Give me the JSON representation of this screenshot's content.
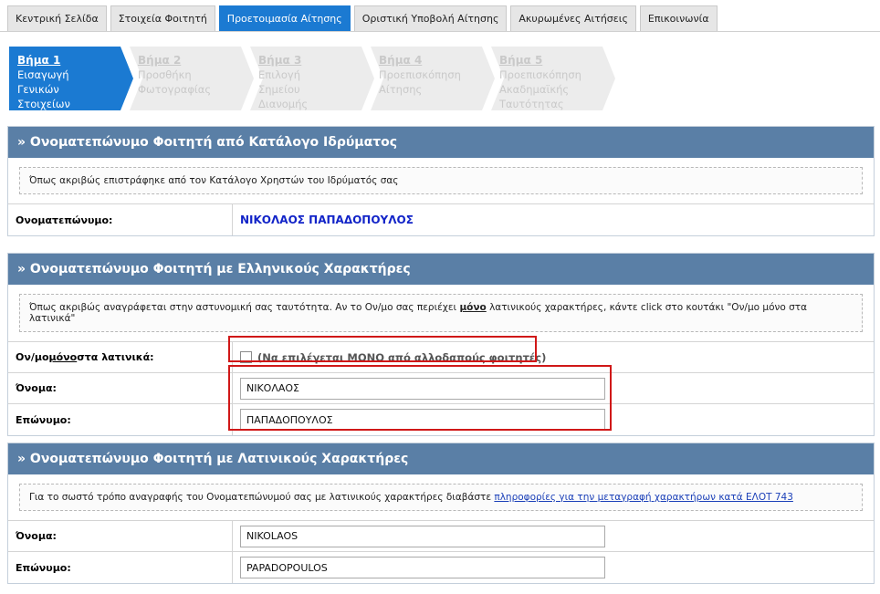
{
  "tabs": [
    {
      "label": "Κεντρική Σελίδα",
      "active": false
    },
    {
      "label": "Στοιχεία Φοιτητή",
      "active": false
    },
    {
      "label": "Προετοιμασία Αίτησης",
      "active": true
    },
    {
      "label": "Οριστική Υποβολή Αίτησης",
      "active": false
    },
    {
      "label": "Ακυρωμένες Αιτήσεις",
      "active": false
    },
    {
      "label": "Επικοινωνία",
      "active": false
    }
  ],
  "steps": [
    {
      "num": "Βήμα 1",
      "line1": "Εισαγωγή Γενικών",
      "line2": "Στοιχείων",
      "line3": "",
      "active": true
    },
    {
      "num": "Βήμα 2",
      "line1": "Προσθήκη",
      "line2": "Φωτογραφίας",
      "line3": "",
      "active": false
    },
    {
      "num": "Βήμα 3",
      "line1": "Επιλογή Σημείου",
      "line2": "Διανομής",
      "line3": "",
      "active": false
    },
    {
      "num": "Βήμα 4",
      "line1": "Προεπισκόπηση",
      "line2": "Αίτησης",
      "line3": "",
      "active": false
    },
    {
      "num": "Βήμα 5",
      "line1": "Προεπισκόπηση",
      "line2": "Ακαδημαϊκής",
      "line3": "Ταυτότητας",
      "active": false
    }
  ],
  "section1": {
    "title": "» Ονοματεπώνυμο Φοιτητή από Κατάλογο Ιδρύματος",
    "note": "Όπως ακριβώς επιστράφηκε από τον Κατάλογο Χρηστών του Ιδρύματός σας",
    "fullname_label": "Ονοματεπώνυμο:",
    "fullname_value": "ΝΙΚΟΛΑΟΣ ΠΑΠΑΔΟΠΟΥΛΟΣ"
  },
  "section2": {
    "title": "» Ονοματεπώνυμο Φοιτητή με Ελληνικούς Χαρακτήρες",
    "note_pre": "Όπως ακριβώς αναγράφεται στην αστυνομική σας ταυτότητα. Αν το Ον/μο σας περιέχει ",
    "note_em": "μόνο",
    "note_post": " λατινικούς χαρακτήρες, κάντε click στο κουτάκι \"Ον/μο μόνο στα λατινικά\"",
    "latin_label_pre": "Ον/μο ",
    "latin_label_em": "μόνο",
    "latin_label_post": " στα λατινικά:",
    "latin_checkbox_text": "(Να επιλέγεται ΜΟΝΟ από αλλοδαπούς φοιτητές)",
    "first_label": "Όνομα:",
    "first_value": "ΝΙΚΟΛΑΟΣ",
    "last_label": "Επώνυμο:",
    "last_value": "ΠΑΠΑΔΟΠΟΥΛΟΣ"
  },
  "section3": {
    "title": "» Ονοματεπώνυμο Φοιτητή με Λατινικούς Χαρακτήρες",
    "note_pre": "Για το σωστό τρόπο αναγραφής του Ονοματεπώνυμού σας με λατινικούς χαρακτήρες διαβάστε ",
    "note_link": "πληροφορίες για την μεταγραφή χαρακτήρων κατά ΕΛΟΤ 743",
    "first_label": "Όνομα:",
    "first_value": "NIKOLAOS",
    "last_label": "Επώνυμο:",
    "last_value": "PAPADOPOULOS"
  },
  "colors": {
    "accent": "#1b7ad2",
    "section_header": "#5a7fa6",
    "highlight": "#d01818",
    "name_value": "#1224c8"
  }
}
